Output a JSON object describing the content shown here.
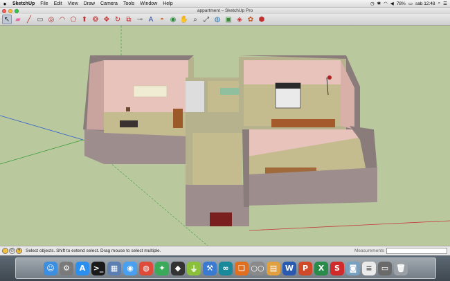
{
  "menubar": {
    "apple": "",
    "items": [
      "SketchUp",
      "File",
      "Edit",
      "View",
      "Draw",
      "Camera",
      "Tools",
      "Window",
      "Help"
    ],
    "battery": "78%",
    "clock": "sab 12:48"
  },
  "window": {
    "title": "appartment – SketchUp Pro"
  },
  "toolbar": {
    "tools": [
      {
        "icon": "select-arrow-icon",
        "glyph": "↖",
        "color": "#222",
        "selected": true
      },
      {
        "icon": "eraser-icon",
        "glyph": "▰",
        "color": "#e46aa0"
      },
      {
        "icon": "pencil-line-icon",
        "glyph": "╱",
        "color": "#b03030"
      },
      {
        "icon": "rectangle-icon",
        "glyph": "▭",
        "color": "#5a5a5a"
      },
      {
        "icon": "circle-icon",
        "glyph": "◎",
        "color": "#b03030"
      },
      {
        "icon": "arc-icon",
        "glyph": "◠",
        "color": "#b03030"
      },
      {
        "icon": "polygon-icon",
        "glyph": "⬠",
        "color": "#b03030"
      },
      {
        "icon": "push-pull-icon",
        "glyph": "⬆",
        "color": "#c03030"
      },
      {
        "icon": "follow-me-icon",
        "glyph": "❂",
        "color": "#c03030"
      },
      {
        "icon": "move-icon",
        "glyph": "✥",
        "color": "#c82020"
      },
      {
        "icon": "rotate-icon",
        "glyph": "↻",
        "color": "#c82020"
      },
      {
        "icon": "scale-icon",
        "glyph": "⧉",
        "color": "#c82020"
      },
      {
        "icon": "tape-measure-icon",
        "glyph": "⊸",
        "color": "#6a6a6a"
      },
      {
        "icon": "text-icon",
        "glyph": "A",
        "color": "#3050a0"
      },
      {
        "icon": "paint-bucket-icon",
        "glyph": "◓",
        "color": "#c06020"
      },
      {
        "icon": "orbit-icon",
        "glyph": "◉",
        "color": "#2a8a3a"
      },
      {
        "icon": "pan-icon",
        "glyph": "✋",
        "color": "#555"
      },
      {
        "icon": "zoom-icon",
        "glyph": "⌕",
        "color": "#333"
      },
      {
        "icon": "zoom-extents-icon",
        "glyph": "⤢",
        "color": "#333"
      },
      {
        "icon": "previous-view-icon",
        "glyph": "◍",
        "color": "#2a7ab0"
      },
      {
        "icon": "warehouse-icon",
        "glyph": "▣",
        "color": "#3a8a3a"
      },
      {
        "icon": "share-model-icon",
        "glyph": "◈",
        "color": "#c03030"
      },
      {
        "icon": "components-icon",
        "glyph": "✿",
        "color": "#c05020"
      },
      {
        "icon": "extension-warehouse-icon",
        "glyph": "⬢",
        "color": "#c03030"
      }
    ]
  },
  "statusbar": {
    "icons": [
      "geo-location-icon",
      "credits-icon",
      "help-icon"
    ],
    "hint": "Select objects. Shift to extend select. Drag mouse to select multiple.",
    "measurements_label": "Measurements",
    "measurements_value": ""
  },
  "dock": {
    "apps": [
      {
        "icon": "finder-icon",
        "glyph": "☺",
        "bg": "#3b8ee0"
      },
      {
        "icon": "system-preferences-icon",
        "glyph": "⚙",
        "bg": "#7a7a7a"
      },
      {
        "icon": "app-store-icon",
        "glyph": "A",
        "bg": "#2b8ff0"
      },
      {
        "icon": "terminal-icon",
        "glyph": ">_",
        "bg": "#1a1a1a"
      },
      {
        "icon": "preview-icon",
        "glyph": "▦",
        "bg": "#5a7fb0"
      },
      {
        "icon": "messages-icon",
        "glyph": "◉",
        "bg": "#4aa0f0"
      },
      {
        "icon": "chrome-icon",
        "glyph": "◍",
        "bg": "#e04a3a"
      },
      {
        "icon": "maps-icon",
        "glyph": "✦",
        "bg": "#3aaa5a"
      },
      {
        "icon": "unity-icon",
        "glyph": "◆",
        "bg": "#333333"
      },
      {
        "icon": "android-file-transfer-icon",
        "glyph": "⏚",
        "bg": "#8ac03a"
      },
      {
        "icon": "xcode-icon",
        "glyph": "⚒",
        "bg": "#3a7ad0"
      },
      {
        "icon": "arduino-icon",
        "glyph": "∞",
        "bg": "#1a8a9a"
      },
      {
        "icon": "sketchup-icon",
        "glyph": "❏",
        "bg": "#e07020"
      },
      {
        "icon": "preview-glasses-icon",
        "glyph": "○○",
        "bg": "#8a8a8a"
      },
      {
        "icon": "ibooks-icon",
        "glyph": "▤",
        "bg": "#e0a040"
      },
      {
        "icon": "word-icon",
        "glyph": "W",
        "bg": "#2a5ab0"
      },
      {
        "icon": "powerpoint-icon",
        "glyph": "P",
        "bg": "#d04a2a"
      },
      {
        "icon": "excel-icon",
        "glyph": "X",
        "bg": "#2a8a4a"
      },
      {
        "icon": "sketchup-pro-icon",
        "glyph": "S",
        "bg": "#d02a2a"
      },
      {
        "icon": "camera-icon",
        "glyph": "◙",
        "bg": "#7aa0c0"
      },
      {
        "icon": "document-icon",
        "glyph": "≡",
        "bg": "#eaeaea"
      },
      {
        "icon": "image-capture-icon",
        "glyph": "▭",
        "bg": "#6a6a6a"
      },
      {
        "icon": "trash-icon",
        "glyph": "🗑",
        "bg": "#9aa0a6"
      }
    ]
  },
  "colors": {
    "background": "#b9c99d",
    "wall": "#9e8e8e",
    "wall_interior": "#e4bcb4",
    "floor": "#b7b28e"
  }
}
